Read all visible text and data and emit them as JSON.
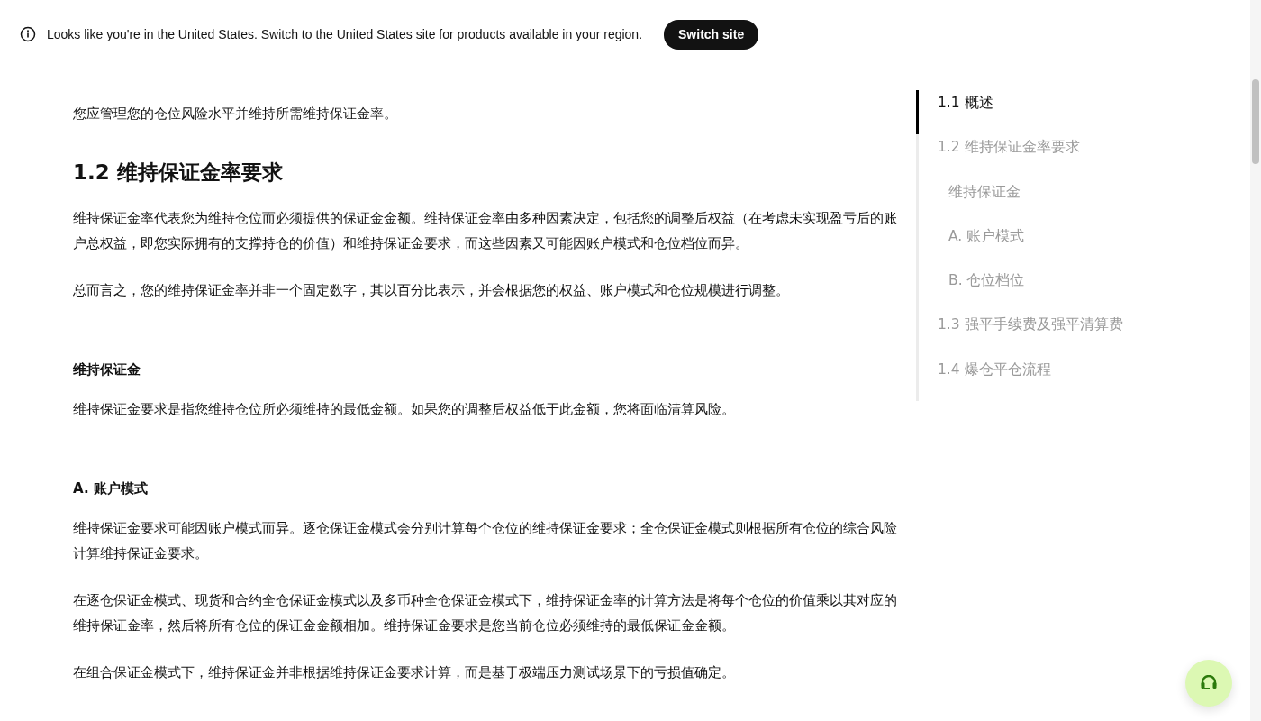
{
  "banner": {
    "message": "Looks like you're in the United States. Switch to the United States site for products available in your region.",
    "button": "Switch site"
  },
  "article": [
    {
      "kind": "paragraph",
      "text": "您应管理您的仓位风险水平并维持所需维持保证金率。"
    },
    {
      "kind": "heading",
      "text": "1.2 维持保证金率要求"
    },
    {
      "kind": "paragraph",
      "text": "维持保证金率代表您为维持仓位而必须提供的保证金金额。维持保证金率由多种因素决定，包括您的调整后权益（在考虑未实现盈亏后的账户总权益，即您实际拥有的支撑持仓的价值）和维持保证金要求，而这些因素又可能因账户模式和仓位档位而异。"
    },
    {
      "kind": "paragraph",
      "text": "总而言之，您的维持保证金率并非一个固定数字，其以百分比表示，并会根据您的权益、账户模式和仓位规模进行调整。"
    },
    {
      "kind": "subheading",
      "text": "维持保证金"
    },
    {
      "kind": "paragraph",
      "text": "维持保证金要求是指您维持仓位所必须维持的最低金额。如果您的调整后权益低于此金额，您将面临清算风险。"
    },
    {
      "kind": "subheading",
      "text": "A. 账户模式"
    },
    {
      "kind": "paragraph",
      "text": "维持保证金要求可能因账户模式而异。逐仓保证金模式会分别计算每个仓位的维持保证金要求；全仓保证金模式则根据所有仓位的综合风险计算维持保证金要求。"
    },
    {
      "kind": "paragraph",
      "text": "在逐仓保证金模式、现货和合约全仓保证金模式以及多币种全仓保证金模式下，维持保证金率的计算方法是将每个仓位的价值乘以其对应的维持保证金率，然后将所有仓位的保证金金额相加。维持保证金要求是您当前仓位必须维持的最低保证金金额。"
    },
    {
      "kind": "paragraph",
      "text": "在组合保证金模式下，维持保证金并非根据维持保证金要求计算，而是基于极端压力测试场景下的亏损值确定。"
    }
  ],
  "toc": [
    {
      "label": "1.1 概述",
      "selected": true
    },
    {
      "label": "1.2 维持保证金率要求",
      "selected": false,
      "children": [
        {
          "label": "维持保证金",
          "selected": false
        },
        {
          "label": "A. 账户模式",
          "selected": false
        },
        {
          "label": "B. 仓位档位",
          "selected": false
        }
      ]
    },
    {
      "label": "1.3 强平手续费及强平清算费",
      "selected": false
    },
    {
      "label": "1.4 爆仓平仓流程",
      "selected": false
    }
  ]
}
